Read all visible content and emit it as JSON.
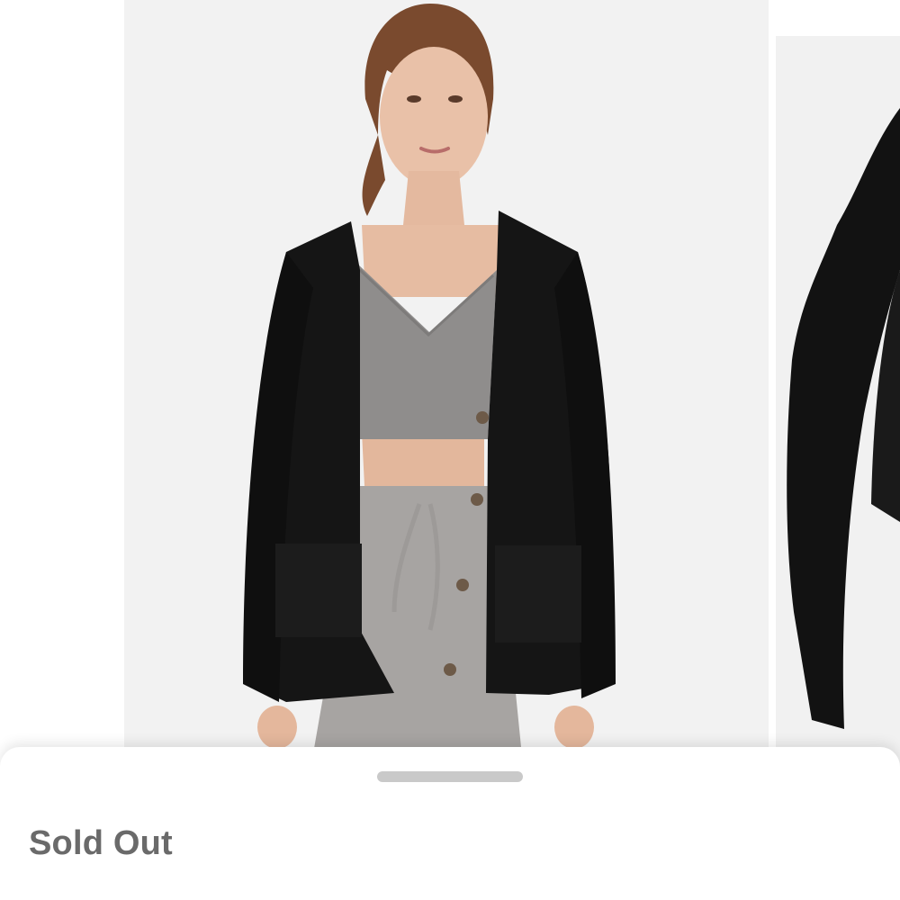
{
  "listing": {
    "status_label": "Sold Out"
  },
  "gallery": {
    "images": [
      {
        "name": "model-wearing-black-cardigan-front"
      },
      {
        "name": "black-cardigan-product-closeup"
      }
    ]
  },
  "colors": {
    "page_background": "#ffffff",
    "photo_background": "#f2f2f2",
    "status_text": "#6a6a6a",
    "grabber": "#c9c9c9"
  }
}
